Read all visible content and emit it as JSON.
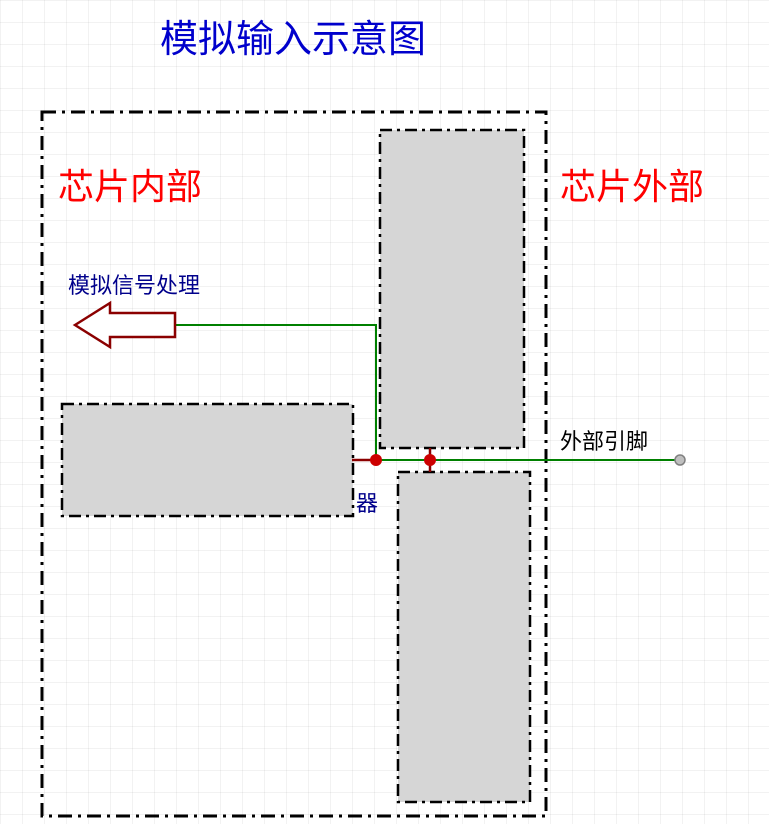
{
  "title": "模拟输入示意图",
  "labels": {
    "chip_inside": "芯片内部",
    "chip_outside": "芯片外部",
    "analog_signal_processing": "模拟信号处理",
    "external_pin": "外部引脚",
    "device_suffix": "器"
  },
  "colors": {
    "title": "#0000cc",
    "red_text": "#ff0000",
    "wire_green": "#008000",
    "wire_darkred": "#8b0000",
    "node_fill": "#cc0000",
    "box_fill": "#d6d6d6",
    "blue_small": "#00008b"
  }
}
